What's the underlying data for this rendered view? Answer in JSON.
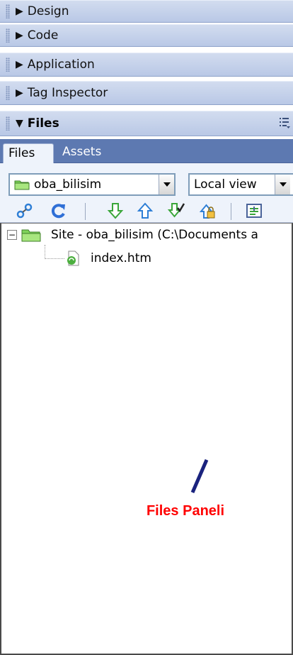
{
  "panels": {
    "design": {
      "label": "Design",
      "state": "collapsed"
    },
    "code": {
      "label": "Code",
      "state": "collapsed"
    },
    "application": {
      "label": "Application",
      "state": "collapsed"
    },
    "tag_inspector": {
      "label": "Tag Inspector",
      "state": "collapsed"
    },
    "files": {
      "label": "Files",
      "state": "expanded"
    }
  },
  "tabs": [
    {
      "label": "Files",
      "active": true
    },
    {
      "label": "Assets",
      "active": false
    }
  ],
  "site_select": {
    "value": "oba_bilisim"
  },
  "view_select": {
    "value": "Local view"
  },
  "toolbar_icons": [
    "connect-icon",
    "refresh-icon",
    "get-files-icon",
    "put-files-icon",
    "check-out-icon",
    "check-in-icon",
    "expand-icon"
  ],
  "tree": {
    "root": {
      "label": "Site - oba_bilisim (C:\\Documents a",
      "expander": "−"
    },
    "children": [
      {
        "label": "index.htm"
      }
    ]
  },
  "annotation": {
    "label": "Files Paneli",
    "color": "#ff0000"
  },
  "colors": {
    "header": "#c5d2ea",
    "tabbar": "#5d79b1",
    "arrow_green": "#3aa63a",
    "arrow_blue": "#2f7fd6"
  }
}
